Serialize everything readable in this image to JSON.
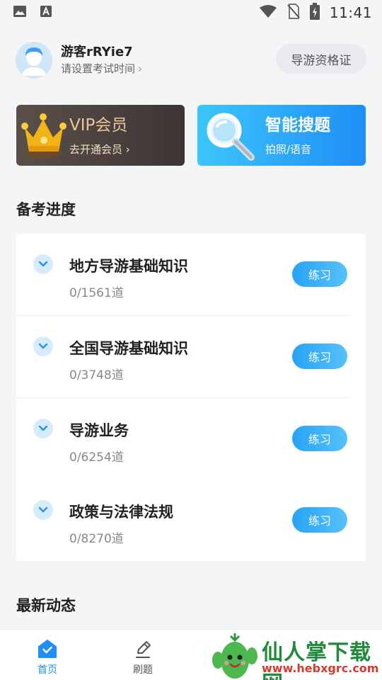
{
  "status_bar": {
    "time": "11:41",
    "icons": [
      "image-icon",
      "font-icon",
      "wifi-icon",
      "no-sim-icon",
      "battery-charging-icon"
    ]
  },
  "profile": {
    "username": "游客rRYie7",
    "exam_time_prompt": "请设置考试时间",
    "chevron": "›",
    "cert_button": "导游资格证"
  },
  "promos": {
    "vip": {
      "title": "VIP会员",
      "subtitle": "去开通会员 ›",
      "icon": "crown-icon"
    },
    "search": {
      "title": "智能搜题",
      "subtitle": "拍照/语音",
      "icon": "magnifier-icon"
    }
  },
  "sections": {
    "progress_title": "备考进度",
    "news_title": "最新动态"
  },
  "subjects": [
    {
      "name": "地方导游基础知识",
      "count": "0/1561道",
      "action": "练习"
    },
    {
      "name": "全国导游基础知识",
      "count": "0/3748道",
      "action": "练习"
    },
    {
      "name": "导游业务",
      "count": "0/6254道",
      "action": "练习"
    },
    {
      "name": "政策与法律法规",
      "count": "0/8270道",
      "action": "练习"
    }
  ],
  "bottom_nav": {
    "home": "首页",
    "practice": "刷题"
  },
  "watermark": {
    "title": "仙人掌下载网",
    "url": "www.hebxgrc.com"
  },
  "colors": {
    "accent": "#1f8ef6",
    "practice_button": "#3eb3f8",
    "vip_gold": "#e9c59a",
    "background": "#f4f5f7"
  }
}
